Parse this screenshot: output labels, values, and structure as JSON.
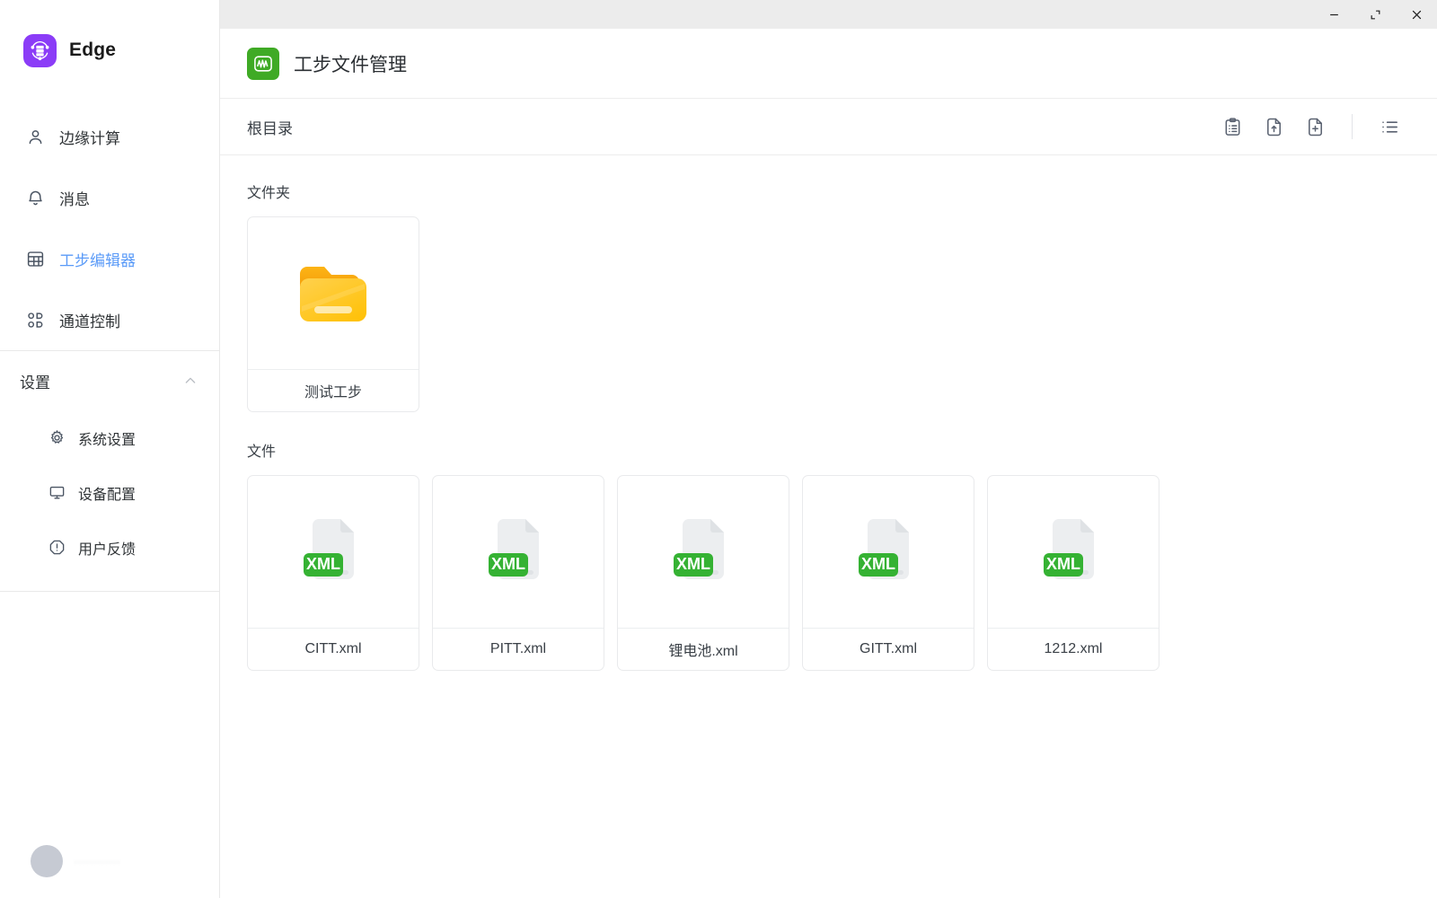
{
  "window": {
    "controls": [
      {
        "name": "minimize",
        "glyph": "minimize-icon"
      },
      {
        "name": "restore",
        "glyph": "restore-icon"
      },
      {
        "name": "close",
        "glyph": "close-icon"
      }
    ]
  },
  "sidebar": {
    "brand": {
      "name": "Edge",
      "icon": "edge-server-logo-icon",
      "color": "#8b3cf7"
    },
    "nav": [
      {
        "label": "边缘计算",
        "icon": "user-icon",
        "active": false
      },
      {
        "label": "消息",
        "icon": "bell-icon",
        "active": false
      },
      {
        "label": "工步编辑器",
        "icon": "table-grid-icon",
        "active": true
      },
      {
        "label": "通道控制",
        "icon": "nodes-icon",
        "active": false
      }
    ],
    "settings": {
      "label": "设置",
      "expanded": true,
      "chevron": "chevron-up-icon",
      "items": [
        {
          "label": "系统设置",
          "icon": "gear-icon"
        },
        {
          "label": "设备配置",
          "icon": "monitor-icon"
        },
        {
          "label": "用户反馈",
          "icon": "exclamation-octagon-icon"
        }
      ]
    },
    "user": {
      "name": "",
      "avatar": "avatar-icon"
    }
  },
  "app": {
    "title": "工步文件管理",
    "logo_icon": "waveform-logo-icon",
    "logo_color": "#3faa25"
  },
  "breadcrumb": {
    "path": "根目录",
    "tools": [
      {
        "name": "clipboard-list-icon",
        "label": "clipboard-list-icon"
      },
      {
        "name": "file-upload-icon",
        "label": "file-upload-icon"
      },
      {
        "name": "file-add-icon",
        "label": "file-add-icon"
      },
      {
        "name": "list-view-icon",
        "label": "list-view-icon"
      }
    ]
  },
  "sections": {
    "folders": {
      "title": "文件夹",
      "items": [
        {
          "name": "测试工步",
          "icon": "folder-icon"
        }
      ]
    },
    "files": {
      "title": "文件",
      "items": [
        {
          "name": "CITT.xml",
          "icon": "xml-file-icon",
          "badge": "XML"
        },
        {
          "name": "PITT.xml",
          "icon": "xml-file-icon",
          "badge": "XML"
        },
        {
          "name": "锂电池.xml",
          "icon": "xml-file-icon",
          "badge": "XML"
        },
        {
          "name": "GITT.xml",
          "icon": "xml-file-icon",
          "badge": "XML"
        },
        {
          "name": "1212.xml",
          "icon": "xml-file-icon",
          "badge": "XML"
        }
      ]
    }
  },
  "colors": {
    "accent_blue": "#5b9bf8",
    "brand_purple": "#8b3cf7",
    "app_green": "#3faa25",
    "folder_yellow": "#ffc223",
    "titlebar_grey": "#ececec"
  }
}
